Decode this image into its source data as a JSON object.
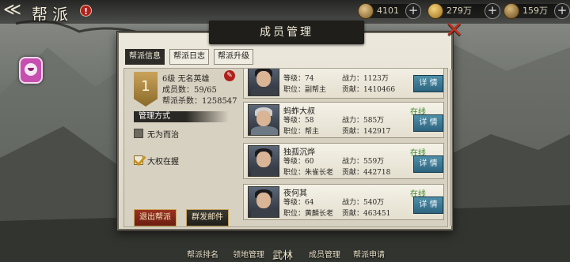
{
  "header": {
    "title": "帮派",
    "alert_icon": "!",
    "resources": [
      {
        "icon": "ingot-icon",
        "value": "4101",
        "add": "+"
      },
      {
        "icon": "coin-icon",
        "value": "279万",
        "add": "+"
      },
      {
        "icon": "copper-icon",
        "value": "159万",
        "add": "+"
      }
    ]
  },
  "dialog": {
    "title": "成员管理",
    "close": "✕",
    "tabs": [
      "帮派信息",
      "帮派日志",
      "帮派升级"
    ],
    "active_tab": 0,
    "guild": {
      "level": "1",
      "level_text": "6级",
      "name": "无名英雄",
      "members": "成员数：59/65",
      "kills": "帮派杀数：1258547"
    },
    "manage": {
      "label": "管理方式",
      "options": [
        {
          "label": "无为而治",
          "checked": false
        },
        {
          "label": "大权在握",
          "checked": true
        }
      ]
    },
    "buttons": {
      "leave": "退出帮派",
      "mail": "群发邮件"
    },
    "members": [
      {
        "name": "",
        "status": "",
        "level": "等级：74",
        "power": "战力：1123万",
        "title": "职位：副帮主",
        "contrib": "贡献：1410466",
        "detail": "详 情"
      },
      {
        "name": "蚂蚱大叔",
        "status": "在线",
        "level": "等级：58",
        "power": "战力：585万",
        "title": "职位：帮主",
        "contrib": "贡献：142917",
        "detail": "详 情"
      },
      {
        "name": "独孤沉烨",
        "status": "在线",
        "level": "等级：60",
        "power": "战力：559万",
        "title": "职位：朱雀长老",
        "contrib": "贡献：442718",
        "detail": "详 情"
      },
      {
        "name": "夜何其",
        "status": "在线",
        "level": "等级：64",
        "power": "战力：540万",
        "title": "职位：黄麟长老",
        "contrib": "贡献：463451",
        "detail": "详 情"
      }
    ]
  },
  "bottom_nav": [
    "帮派排名",
    "领地管理",
    "武林",
    "成员管理",
    "帮派申请"
  ]
}
